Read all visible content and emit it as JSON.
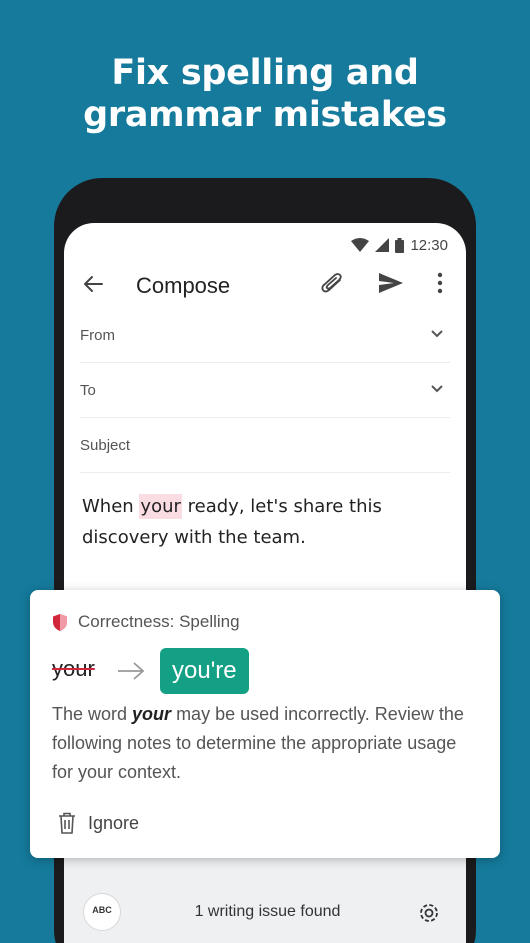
{
  "headline": {
    "line1": "Fix spelling and",
    "line2": "grammar mistakes"
  },
  "status": {
    "time": "12:30"
  },
  "appbar": {
    "title": "Compose"
  },
  "fields": {
    "from": "From",
    "to": "To",
    "subject": "Subject"
  },
  "message": {
    "before": "When ",
    "highlight": "your",
    "after": " ready, let's share this discovery with the team."
  },
  "card": {
    "category": "Correctness: Spelling",
    "wrong_word": "your",
    "suggestion": "you're",
    "desc_before": "The word ",
    "desc_word": "your",
    "desc_after": " may be used incorrectly. Review the following notes to determine the appropriate usage for your context.",
    "ignore_label": "Ignore"
  },
  "bottom": {
    "abc": "ABC",
    "issues": "1 writing issue found"
  },
  "colors": {
    "background": "#157a9b",
    "suggestion": "#14a085",
    "error": "#d0273d",
    "highlight": "#f9dde3"
  },
  "icons": [
    "wifi-icon",
    "signal-icon",
    "battery-icon",
    "back-arrow-icon",
    "attach-icon",
    "send-icon",
    "more-icon",
    "chevron-down-icon",
    "shield-icon",
    "arrow-right-icon",
    "trash-icon",
    "gear-icon"
  ]
}
